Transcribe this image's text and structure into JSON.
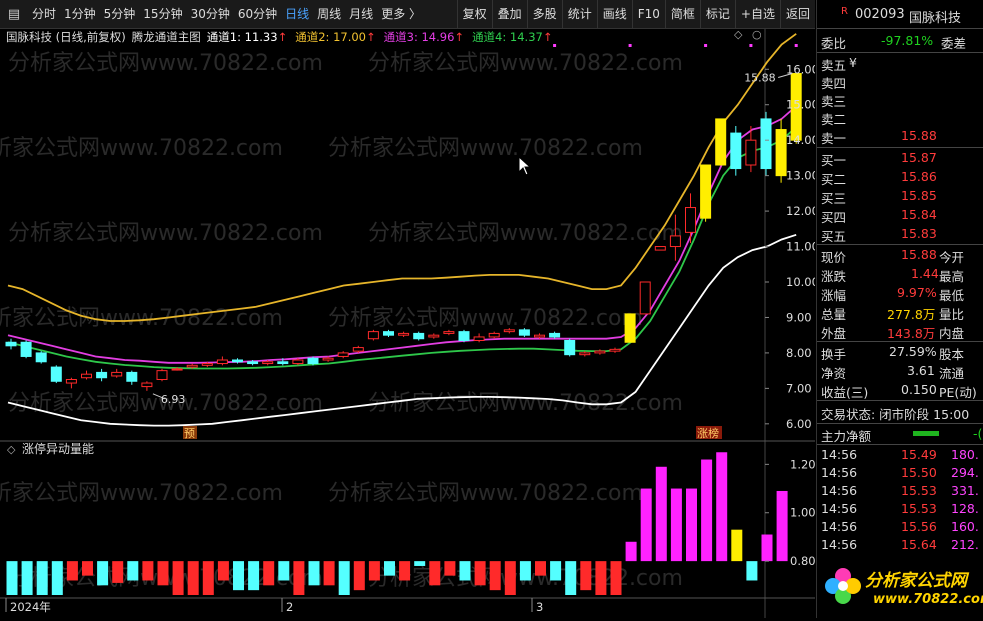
{
  "toolbar": {
    "periods": [
      "分时",
      "1分钟",
      "5分钟",
      "15分钟",
      "30分钟",
      "60分钟",
      "日线",
      "周线",
      "月线",
      "更多 〉"
    ],
    "active_period": 6,
    "tools": [
      "复权",
      "叠加",
      "多股",
      "统计",
      "画线",
      "F10",
      "简框",
      "标记",
      "+自选",
      "返回"
    ]
  },
  "legend": {
    "stock": "国脉科技 (日线,前复权)",
    "indicator": "腾龙通道主图",
    "ch1": "通道1: 11.33",
    "ch2": "通道2: 17.00",
    "ch3": "通道3: 14.96",
    "ch4": "通道4: 14.37",
    "arrow": "↑"
  },
  "price_axis": [
    "16.00",
    "15.00",
    "14.00",
    "13.00",
    "12.00",
    "11.00",
    "10.00",
    "9.00",
    "8.00",
    "7.00",
    "6.00"
  ],
  "volume_axis": [
    "1.20",
    "1.00",
    "0.80"
  ],
  "annotations": {
    "high": "15.88",
    "low": "6.93",
    "yu": "预",
    "zhang": "涨榜"
  },
  "sub_title": "涨停异动量能",
  "date_axis": [
    "2024年",
    "2",
    "3"
  ],
  "watermark": [
    "分析家公式网www.70822.com",
    "分析家公式网www.70822.com"
  ],
  "quote": {
    "badge": "R",
    "code": "002093",
    "name": "国脉科技",
    "weibi_label": "委比",
    "weibi_value": "-97.81%",
    "weicha_label": "委差",
    "sell_labels": [
      "卖五",
      "卖四",
      "卖三",
      "卖二",
      "卖一"
    ],
    "sell5_extra": "¥",
    "sell1_price": "15.88",
    "buy_labels": [
      "买一",
      "买二",
      "买三",
      "买四",
      "买五"
    ],
    "buy_prices": [
      "15.87",
      "15.86",
      "15.85",
      "15.84",
      "15.83"
    ],
    "stats_left": [
      {
        "label": "现价",
        "value": "15.88",
        "color": "red"
      },
      {
        "label": "涨跌",
        "value": "1.44",
        "color": "red"
      },
      {
        "label": "涨幅",
        "value": "9.97%",
        "color": "red"
      },
      {
        "label": "总量",
        "value": "277.8万",
        "color": "yellow"
      },
      {
        "label": "外盘",
        "value": "143.8万",
        "color": "red"
      }
    ],
    "stats_right": [
      "今开",
      "最高",
      "最低",
      "量比",
      "内盘"
    ],
    "stats2": [
      {
        "label": "换手",
        "value": "27.59%",
        "right": "股本"
      },
      {
        "label": "净资",
        "value": "3.61",
        "right": "流通"
      },
      {
        "label": "收益(三)",
        "value": "0.150",
        "right": "PE(动)"
      }
    ],
    "trade_status": "交易状态: 闭市阶段 15:00",
    "net_label": "主力净额",
    "net_value": "-(",
    "ticks": [
      {
        "time": "14:56",
        "price": "15.49",
        "vol": "180."
      },
      {
        "time": "14:56",
        "price": "15.50",
        "vol": "294."
      },
      {
        "time": "14:56",
        "price": "15.53",
        "vol": "331."
      },
      {
        "time": "14:56",
        "price": "15.53",
        "vol": "128."
      },
      {
        "time": "14:56",
        "price": "15.56",
        "vol": "160."
      },
      {
        "time": "14:56",
        "price": "15.64",
        "vol": "212."
      }
    ],
    "logo_text": "分析家公式网",
    "logo_url": "www.70822.com"
  },
  "chart_data": {
    "type": "candlestick",
    "price_range": [
      5.6,
      16.6
    ],
    "candles": [
      {
        "o": 8.3,
        "c": 8.2,
        "h": 8.4,
        "l": 8.1,
        "col": "cyan"
      },
      {
        "o": 8.3,
        "c": 7.9,
        "h": 8.35,
        "l": 7.85,
        "col": "cyan"
      },
      {
        "o": 8.0,
        "c": 7.75,
        "h": 8.05,
        "l": 7.7,
        "col": "cyan"
      },
      {
        "o": 7.6,
        "c": 7.2,
        "h": 7.65,
        "l": 7.15,
        "col": "cyan"
      },
      {
        "o": 7.15,
        "c": 7.25,
        "h": 7.3,
        "l": 7.0,
        "col": "red"
      },
      {
        "o": 7.3,
        "c": 7.4,
        "h": 7.5,
        "l": 7.25,
        "col": "red"
      },
      {
        "o": 7.45,
        "c": 7.3,
        "h": 7.55,
        "l": 7.2,
        "col": "cyan"
      },
      {
        "o": 7.35,
        "c": 7.45,
        "h": 7.55,
        "l": 7.3,
        "col": "red"
      },
      {
        "o": 7.45,
        "c": 7.2,
        "h": 7.5,
        "l": 7.1,
        "col": "cyan"
      },
      {
        "o": 7.05,
        "c": 7.15,
        "h": 7.2,
        "l": 6.93,
        "col": "red"
      },
      {
        "o": 7.25,
        "c": 7.5,
        "h": 7.55,
        "l": 7.2,
        "col": "red"
      },
      {
        "o": 7.55,
        "c": 7.55,
        "h": 7.6,
        "l": 7.5,
        "col": "red"
      },
      {
        "o": 7.6,
        "c": 7.65,
        "h": 7.7,
        "l": 7.55,
        "col": "red"
      },
      {
        "o": 7.65,
        "c": 7.7,
        "h": 7.75,
        "l": 7.6,
        "col": "red"
      },
      {
        "o": 7.7,
        "c": 7.8,
        "h": 7.9,
        "l": 7.65,
        "col": "red"
      },
      {
        "o": 7.8,
        "c": 7.75,
        "h": 7.85,
        "l": 7.7,
        "col": "cyan"
      },
      {
        "o": 7.75,
        "c": 7.7,
        "h": 7.8,
        "l": 7.65,
        "col": "cyan"
      },
      {
        "o": 7.7,
        "c": 7.75,
        "h": 7.8,
        "l": 7.65,
        "col": "red"
      },
      {
        "o": 7.75,
        "c": 7.7,
        "h": 7.85,
        "l": 7.65,
        "col": "cyan"
      },
      {
        "o": 7.7,
        "c": 7.8,
        "h": 7.85,
        "l": 7.65,
        "col": "red"
      },
      {
        "o": 7.85,
        "c": 7.7,
        "h": 7.9,
        "l": 7.65,
        "col": "cyan"
      },
      {
        "o": 7.8,
        "c": 7.85,
        "h": 7.9,
        "l": 7.75,
        "col": "red"
      },
      {
        "o": 7.9,
        "c": 8.0,
        "h": 8.05,
        "l": 7.85,
        "col": "red"
      },
      {
        "o": 8.05,
        "c": 8.15,
        "h": 8.2,
        "l": 8.0,
        "col": "red"
      },
      {
        "o": 8.4,
        "c": 8.6,
        "h": 8.65,
        "l": 8.35,
        "col": "red"
      },
      {
        "o": 8.6,
        "c": 8.5,
        "h": 8.65,
        "l": 8.45,
        "col": "cyan"
      },
      {
        "o": 8.5,
        "c": 8.55,
        "h": 8.6,
        "l": 8.45,
        "col": "red"
      },
      {
        "o": 8.55,
        "c": 8.4,
        "h": 8.6,
        "l": 8.35,
        "col": "cyan"
      },
      {
        "o": 8.45,
        "c": 8.5,
        "h": 8.55,
        "l": 8.4,
        "col": "red"
      },
      {
        "o": 8.55,
        "c": 8.6,
        "h": 8.65,
        "l": 8.5,
        "col": "red"
      },
      {
        "o": 8.6,
        "c": 8.35,
        "h": 8.65,
        "l": 8.3,
        "col": "cyan"
      },
      {
        "o": 8.35,
        "c": 8.45,
        "h": 8.55,
        "l": 8.3,
        "col": "red"
      },
      {
        "o": 8.45,
        "c": 8.55,
        "h": 8.6,
        "l": 8.4,
        "col": "red"
      },
      {
        "o": 8.6,
        "c": 8.65,
        "h": 8.7,
        "l": 8.55,
        "col": "red"
      },
      {
        "o": 8.65,
        "c": 8.5,
        "h": 8.7,
        "l": 8.45,
        "col": "cyan"
      },
      {
        "o": 8.45,
        "c": 8.5,
        "h": 8.55,
        "l": 8.4,
        "col": "red"
      },
      {
        "o": 8.55,
        "c": 8.45,
        "h": 8.6,
        "l": 8.4,
        "col": "cyan"
      },
      {
        "o": 8.35,
        "c": 7.95,
        "h": 8.4,
        "l": 7.9,
        "col": "cyan"
      },
      {
        "o": 7.95,
        "c": 8.0,
        "h": 8.05,
        "l": 7.9,
        "col": "red"
      },
      {
        "o": 8.0,
        "c": 8.05,
        "h": 8.1,
        "l": 7.95,
        "col": "red"
      },
      {
        "o": 8.05,
        "c": 8.1,
        "h": 8.15,
        "l": 8.0,
        "col": "red"
      },
      {
        "o": 8.3,
        "c": 9.1,
        "h": 9.1,
        "l": 8.3,
        "col": "yellow"
      },
      {
        "o": 9.1,
        "c": 10.0,
        "h": 10.0,
        "l": 9.1,
        "col": "red"
      },
      {
        "o": 10.9,
        "c": 11.0,
        "h": 11.0,
        "l": 10.9,
        "col": "red"
      },
      {
        "o": 11.0,
        "c": 11.3,
        "h": 11.9,
        "l": 10.6,
        "col": "red"
      },
      {
        "o": 11.4,
        "c": 12.1,
        "h": 12.5,
        "l": 11.1,
        "col": "red"
      },
      {
        "o": 11.8,
        "c": 13.3,
        "h": 13.3,
        "l": 11.7,
        "col": "yellow"
      },
      {
        "o": 13.3,
        "c": 14.6,
        "h": 14.6,
        "l": 13.3,
        "col": "yellow"
      },
      {
        "o": 14.2,
        "c": 13.2,
        "h": 14.4,
        "l": 13.0,
        "col": "cyan"
      },
      {
        "o": 13.3,
        "c": 14.0,
        "h": 14.4,
        "l": 13.1,
        "col": "red"
      },
      {
        "o": 14.6,
        "c": 13.2,
        "h": 14.8,
        "l": 13.0,
        "col": "cyan"
      },
      {
        "o": 13.0,
        "c": 14.3,
        "h": 14.6,
        "l": 12.8,
        "col": "yellow"
      },
      {
        "o": 14.0,
        "c": 15.88,
        "h": 15.88,
        "l": 13.9,
        "col": "yellow"
      }
    ],
    "channels": {
      "yellow": [
        9.9,
        9.8,
        9.6,
        9.4,
        9.2,
        9.05,
        8.95,
        8.9,
        8.9,
        8.92,
        8.95,
        9.0,
        9.05,
        9.1,
        9.15,
        9.2,
        9.25,
        9.3,
        9.4,
        9.5,
        9.6,
        9.7,
        9.8,
        9.9,
        9.95,
        10.0,
        10.05,
        10.1,
        10.1,
        10.1,
        10.12,
        10.15,
        10.18,
        10.2,
        10.2,
        10.2,
        10.15,
        10.1,
        10.0,
        9.9,
        9.8,
        9.8,
        9.9,
        10.4,
        11.0,
        11.6,
        12.3,
        13.0,
        13.8,
        14.5,
        15.0,
        15.6,
        16.2,
        16.7,
        17.0
      ],
      "magenta": [
        8.5,
        8.4,
        8.3,
        8.2,
        8.1,
        8.0,
        7.9,
        7.85,
        7.8,
        7.78,
        7.75,
        7.72,
        7.72,
        7.72,
        7.73,
        7.74,
        7.75,
        7.77,
        7.8,
        7.82,
        7.85,
        7.88,
        7.9,
        7.95,
        8.0,
        8.05,
        8.1,
        8.15,
        8.2,
        8.25,
        8.3,
        8.33,
        8.36,
        8.38,
        8.4,
        8.4,
        8.4,
        8.4,
        8.4,
        8.4,
        8.4,
        8.4,
        8.45,
        8.7,
        9.2,
        9.9,
        10.6,
        11.5,
        12.5,
        13.4,
        14.0,
        14.3,
        14.4,
        14.6,
        14.96
      ],
      "green": [
        8.3,
        8.2,
        8.1,
        8.0,
        7.9,
        7.82,
        7.75,
        7.7,
        7.66,
        7.63,
        7.6,
        7.58,
        7.57,
        7.56,
        7.56,
        7.56,
        7.57,
        7.58,
        7.6,
        7.62,
        7.65,
        7.68,
        7.7,
        7.75,
        7.8,
        7.84,
        7.88,
        7.92,
        7.96,
        8.0,
        8.03,
        8.06,
        8.08,
        8.1,
        8.11,
        8.12,
        8.12,
        8.1,
        8.08,
        8.06,
        8.05,
        8.05,
        8.1,
        8.4,
        8.9,
        9.6,
        10.3,
        11.2,
        12.2,
        13.0,
        13.5,
        13.7,
        13.8,
        14.0,
        14.37
      ],
      "white": [
        6.6,
        6.5,
        6.4,
        6.3,
        6.2,
        6.1,
        6.05,
        6.0,
        5.98,
        5.96,
        5.95,
        5.95,
        5.96,
        5.98,
        6.0,
        6.05,
        6.1,
        6.15,
        6.2,
        6.25,
        6.3,
        6.35,
        6.4,
        6.45,
        6.5,
        6.55,
        6.6,
        6.65,
        6.7,
        6.72,
        6.74,
        6.75,
        6.76,
        6.76,
        6.75,
        6.74,
        6.72,
        6.7,
        6.66,
        6.6,
        6.55,
        6.55,
        6.6,
        6.9,
        7.5,
        8.1,
        8.7,
        9.3,
        9.9,
        10.4,
        10.7,
        10.9,
        11.0,
        11.2,
        11.33
      ]
    },
    "volume_range": [
      0.66,
      1.28
    ],
    "volume": [
      {
        "v": 0.8,
        "col": "cyan"
      },
      {
        "v": 0.8,
        "col": "cyan"
      },
      {
        "v": 0.8,
        "col": "cyan"
      },
      {
        "v": 0.8,
        "col": "cyan"
      },
      {
        "v": 0.8,
        "col": "red"
      },
      {
        "v": 0.8,
        "col": "red"
      },
      {
        "v": 0.8,
        "col": "cyan"
      },
      {
        "v": 0.8,
        "col": "red"
      },
      {
        "v": 0.8,
        "col": "cyan"
      },
      {
        "v": 0.8,
        "col": "red"
      },
      {
        "v": 0.8,
        "col": "red"
      },
      {
        "v": 0.8,
        "col": "red"
      },
      {
        "v": 0.8,
        "col": "red"
      },
      {
        "v": 0.8,
        "col": "red"
      },
      {
        "v": 0.8,
        "col": "red"
      },
      {
        "v": 0.8,
        "col": "cyan"
      },
      {
        "v": 0.8,
        "col": "cyan"
      },
      {
        "v": 0.8,
        "col": "red"
      },
      {
        "v": 0.8,
        "col": "cyan"
      },
      {
        "v": 0.8,
        "col": "red"
      },
      {
        "v": 0.8,
        "col": "cyan"
      },
      {
        "v": 0.8,
        "col": "red"
      },
      {
        "v": 0.8,
        "col": "cyan"
      },
      {
        "v": 0.8,
        "col": "red"
      },
      {
        "v": 0.8,
        "col": "red"
      },
      {
        "v": 0.8,
        "col": "cyan"
      },
      {
        "v": 0.8,
        "col": "red"
      },
      {
        "v": 0.8,
        "col": "cyan"
      },
      {
        "v": 0.8,
        "col": "red"
      },
      {
        "v": 0.8,
        "col": "red"
      },
      {
        "v": 0.8,
        "col": "cyan"
      },
      {
        "v": 0.8,
        "col": "red"
      },
      {
        "v": 0.8,
        "col": "red"
      },
      {
        "v": 0.8,
        "col": "red"
      },
      {
        "v": 0.8,
        "col": "cyan"
      },
      {
        "v": 0.8,
        "col": "red"
      },
      {
        "v": 0.8,
        "col": "cyan"
      },
      {
        "v": 0.8,
        "col": "cyan"
      },
      {
        "v": 0.8,
        "col": "red"
      },
      {
        "v": 0.8,
        "col": "red"
      },
      {
        "v": 0.8,
        "col": "red"
      },
      {
        "v": 0.88,
        "col": "magenta"
      },
      {
        "v": 1.1,
        "col": "magenta"
      },
      {
        "v": 1.19,
        "col": "magenta"
      },
      {
        "v": 1.1,
        "col": "magenta"
      },
      {
        "v": 1.1,
        "col": "magenta"
      },
      {
        "v": 1.22,
        "col": "magenta"
      },
      {
        "v": 1.25,
        "col": "magenta"
      },
      {
        "v": 0.93,
        "col": "yellow"
      },
      {
        "v": 0.8,
        "col": "cyan"
      },
      {
        "v": 0.91,
        "col": "magenta"
      },
      {
        "v": 1.09,
        "col": "magenta"
      }
    ],
    "volume_down": [
      0,
      0,
      0,
      0,
      0.72,
      0.74,
      0.7,
      0.71,
      0.72,
      0.72,
      0.7,
      0.66,
      0.66,
      0.66,
      0.72,
      0.68,
      0.68,
      0.7,
      0.72,
      0.66,
      0.7,
      0.7,
      0.66,
      0.68,
      0.72,
      0.74,
      0.72,
      0.78,
      0.7,
      0.74,
      0.72,
      0.7,
      0.68,
      0.66,
      0.72,
      0.74,
      0.72,
      0.66,
      0.68,
      0.66,
      0.66,
      0,
      0,
      0,
      0,
      0,
      0,
      0,
      0,
      0.72,
      0,
      0
    ]
  }
}
